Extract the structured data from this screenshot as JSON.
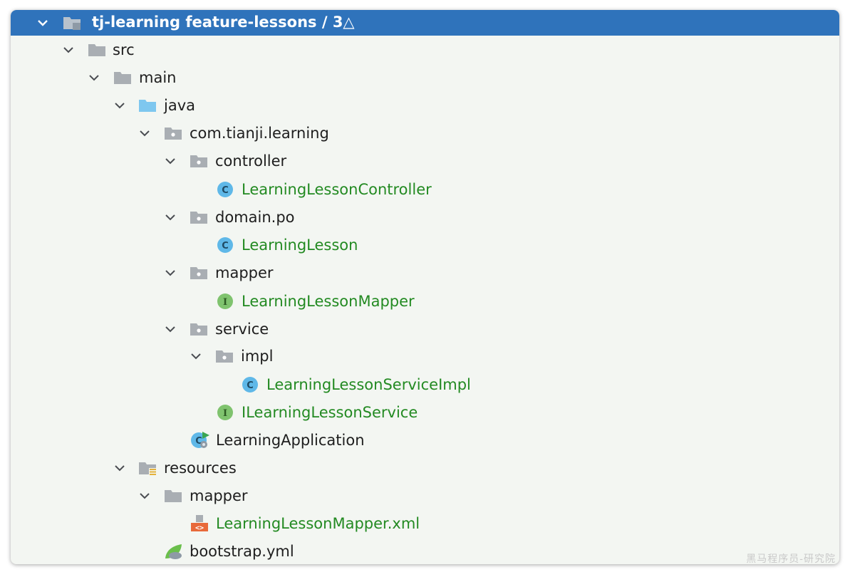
{
  "project": {
    "root": {
      "label": "tj-learning  feature-lessons / 3△",
      "icon": "module-folder-icon"
    },
    "src": "src",
    "main": "main",
    "java": "java",
    "package": "com.tianji.learning",
    "controller": "controller",
    "controller_class": "LearningLessonController",
    "domain_po": "domain.po",
    "domain_class": "LearningLesson",
    "mapper": "mapper",
    "mapper_interface": "LearningLessonMapper",
    "service": "service",
    "impl": "impl",
    "service_impl_class": "LearningLessonServiceImpl",
    "service_interface": "ILearningLessonService",
    "application_class": "LearningApplication",
    "resources": "resources",
    "resources_mapper": "mapper",
    "mapper_xml": "LearningLessonMapper.xml",
    "bootstrap": "bootstrap.yml"
  },
  "colors": {
    "selection": "#2f73bb",
    "vcs_modified": "#238a22",
    "class_icon": "#5fb8e8",
    "interface_icon": "#7fc36e",
    "folder_gray": "#a9aeb3",
    "source_folder_blue": "#7ec7ef"
  },
  "watermark": "黑马程序员-研究院"
}
